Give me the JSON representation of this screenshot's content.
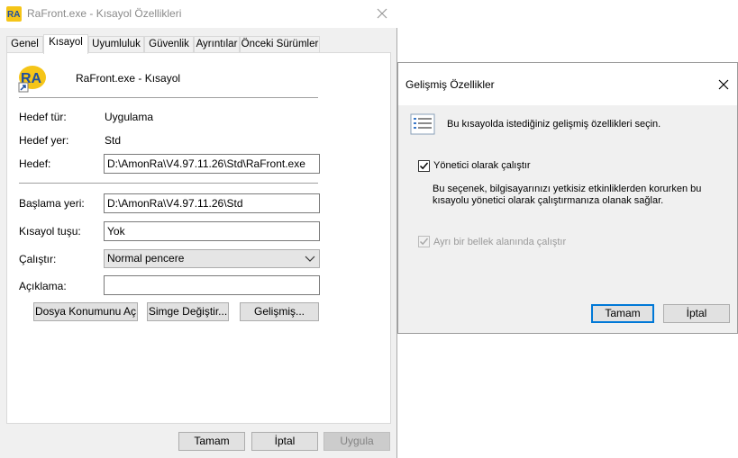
{
  "window": {
    "title": "RaFront.exe - Kısayol Özellikleri",
    "icon_text": "RA"
  },
  "tabs": [
    {
      "label": "Genel",
      "active": false
    },
    {
      "label": "Kısayol",
      "active": true
    },
    {
      "label": "Uyumluluk",
      "active": false
    },
    {
      "label": "Güvenlik",
      "active": false
    },
    {
      "label": "Ayrıntılar",
      "active": false
    },
    {
      "label": "Önceki Sürümler",
      "active": false
    }
  ],
  "shortcut": {
    "name": "RaFront.exe - Kısayol",
    "target_type_label": "Hedef tür:",
    "target_type_value": "Uygulama",
    "target_location_label": "Hedef yer:",
    "target_location_value": "Std",
    "target_label": "Hedef:",
    "target_value": "D:\\AmonRa\\V4.97.11.26\\Std\\RaFront.exe",
    "start_in_label": "Başlama yeri:",
    "start_in_value": "D:\\AmonRa\\V4.97.11.26\\Std",
    "hotkey_label": "Kısayol tuşu:",
    "hotkey_value": "Yok",
    "run_label": "Çalıştır:",
    "run_value": "Normal pencere",
    "comment_label": "Açıklama:",
    "comment_value": ""
  },
  "buttons": {
    "open_location": "Dosya Konumunu Aç",
    "change_icon": "Simge Değiştir...",
    "advanced": "Gelişmiş...",
    "ok": "Tamam",
    "cancel": "İptal",
    "apply": "Uygula"
  },
  "advanced_dialog": {
    "title": "Gelişmiş Özellikler",
    "intro": "Bu kısayolda istediğiniz gelişmiş özellikleri seçin.",
    "run_as_admin_label": "Yönetici olarak çalıştır",
    "run_as_admin_checked": true,
    "description_line1": "Bu seçenek, bilgisayarınızı yetkisiz etkinliklerden korurken bu",
    "description_line2": "kısayolu yönetici olarak çalıştırmanıza olanak sağlar.",
    "separate_memory_label": "Ayrı bir bellek alanında çalıştır",
    "separate_memory_checked": true,
    "separate_memory_disabled": true,
    "ok": "Tamam",
    "cancel": "İptal"
  },
  "colors": {
    "accent": "#0078d7",
    "icon_yellow": "#f5c518",
    "icon_blue": "#1f4fa0"
  }
}
